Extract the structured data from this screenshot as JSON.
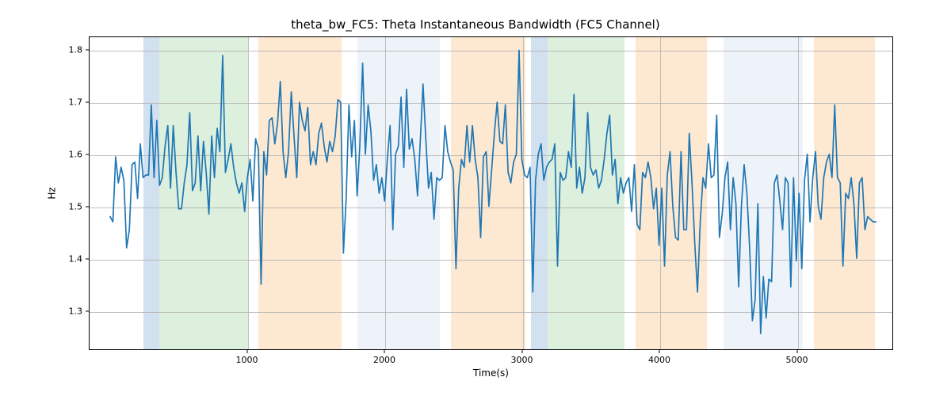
{
  "chart_data": {
    "type": "line",
    "title": "theta_bw_FC5: Theta Instantaneous Bandwidth (FC5 Channel)",
    "xlabel": "Time(s)",
    "ylabel": "Hz",
    "xlim": [
      -150,
      5700
    ],
    "ylim": [
      1.225,
      1.825
    ],
    "xticks": [
      1000,
      2000,
      3000,
      4000,
      5000
    ],
    "yticks": [
      1.3,
      1.4,
      1.5,
      1.6,
      1.7,
      1.8
    ],
    "xtick_labels": [
      "1000",
      "2000",
      "3000",
      "4000",
      "5000"
    ],
    "ytick_labels": [
      "1.3",
      "1.4",
      "1.5",
      "1.6",
      "1.7",
      "1.8"
    ],
    "spans": [
      {
        "start": 240,
        "end": 360,
        "color": "blue"
      },
      {
        "start": 360,
        "end": 1000,
        "color": "green"
      },
      {
        "start": 1080,
        "end": 1680,
        "color": "orange"
      },
      {
        "start": 1800,
        "end": 2400,
        "color": "lblue"
      },
      {
        "start": 2480,
        "end": 3020,
        "color": "orange"
      },
      {
        "start": 3060,
        "end": 3180,
        "color": "blue"
      },
      {
        "start": 3180,
        "end": 3740,
        "color": "green"
      },
      {
        "start": 3820,
        "end": 4340,
        "color": "orange"
      },
      {
        "start": 4460,
        "end": 5040,
        "color": "lblue"
      },
      {
        "start": 5120,
        "end": 5560,
        "color": "orange"
      }
    ],
    "series": [
      {
        "name": "theta_bw_FC5",
        "color": "#1f77b4",
        "x_step": 20,
        "x_start": 0,
        "values": [
          1.48,
          1.47,
          1.595,
          1.545,
          1.575,
          1.55,
          1.42,
          1.455,
          1.58,
          1.585,
          1.515,
          1.62,
          1.555,
          1.56,
          1.56,
          1.695,
          1.555,
          1.665,
          1.54,
          1.555,
          1.615,
          1.655,
          1.535,
          1.655,
          1.565,
          1.495,
          1.495,
          1.545,
          1.58,
          1.68,
          1.53,
          1.545,
          1.635,
          1.53,
          1.625,
          1.565,
          1.485,
          1.635,
          1.555,
          1.65,
          1.605,
          1.79,
          1.565,
          1.59,
          1.62,
          1.575,
          1.545,
          1.525,
          1.545,
          1.49,
          1.555,
          1.59,
          1.51,
          1.63,
          1.61,
          1.35,
          1.605,
          1.56,
          1.665,
          1.67,
          1.62,
          1.66,
          1.74,
          1.605,
          1.555,
          1.605,
          1.72,
          1.635,
          1.555,
          1.7,
          1.665,
          1.645,
          1.69,
          1.58,
          1.605,
          1.58,
          1.64,
          1.66,
          1.615,
          1.585,
          1.625,
          1.605,
          1.635,
          1.705,
          1.7,
          1.41,
          1.515,
          1.695,
          1.595,
          1.665,
          1.52,
          1.62,
          1.775,
          1.6,
          1.695,
          1.645,
          1.55,
          1.58,
          1.525,
          1.555,
          1.51,
          1.59,
          1.655,
          1.455,
          1.6,
          1.615,
          1.71,
          1.575,
          1.725,
          1.61,
          1.63,
          1.59,
          1.52,
          1.625,
          1.735,
          1.63,
          1.535,
          1.565,
          1.475,
          1.555,
          1.55,
          1.555,
          1.655,
          1.605,
          1.585,
          1.57,
          1.38,
          1.535,
          1.59,
          1.575,
          1.655,
          1.585,
          1.655,
          1.59,
          1.555,
          1.44,
          1.595,
          1.605,
          1.5,
          1.57,
          1.64,
          1.7,
          1.625,
          1.62,
          1.695,
          1.565,
          1.545,
          1.585,
          1.6,
          1.8,
          1.59,
          1.56,
          1.555,
          1.575,
          1.335,
          1.55,
          1.6,
          1.62,
          1.55,
          1.575,
          1.585,
          1.59,
          1.62,
          1.385,
          1.565,
          1.55,
          1.555,
          1.605,
          1.575,
          1.715,
          1.535,
          1.575,
          1.525,
          1.555,
          1.68,
          1.575,
          1.56,
          1.57,
          1.535,
          1.55,
          1.59,
          1.64,
          1.675,
          1.56,
          1.59,
          1.505,
          1.555,
          1.525,
          1.545,
          1.555,
          1.49,
          1.58,
          1.465,
          1.455,
          1.565,
          1.555,
          1.585,
          1.555,
          1.495,
          1.535,
          1.425,
          1.535,
          1.385,
          1.56,
          1.605,
          1.5,
          1.44,
          1.435,
          1.605,
          1.455,
          1.455,
          1.64,
          1.545,
          1.43,
          1.335,
          1.47,
          1.555,
          1.535,
          1.62,
          1.555,
          1.56,
          1.675,
          1.44,
          1.485,
          1.555,
          1.585,
          1.455,
          1.555,
          1.505,
          1.345,
          1.5,
          1.58,
          1.525,
          1.42,
          1.28,
          1.32,
          1.505,
          1.255,
          1.365,
          1.285,
          1.36,
          1.355,
          1.545,
          1.56,
          1.51,
          1.455,
          1.555,
          1.545,
          1.345,
          1.555,
          1.395,
          1.525,
          1.38,
          1.55,
          1.6,
          1.47,
          1.555,
          1.605,
          1.5,
          1.475,
          1.555,
          1.585,
          1.6,
          1.555,
          1.695,
          1.555,
          1.545,
          1.385,
          1.525,
          1.515,
          1.555,
          1.505,
          1.4,
          1.545,
          1.555,
          1.455,
          1.48,
          1.475,
          1.47,
          1.47
        ]
      }
    ]
  }
}
